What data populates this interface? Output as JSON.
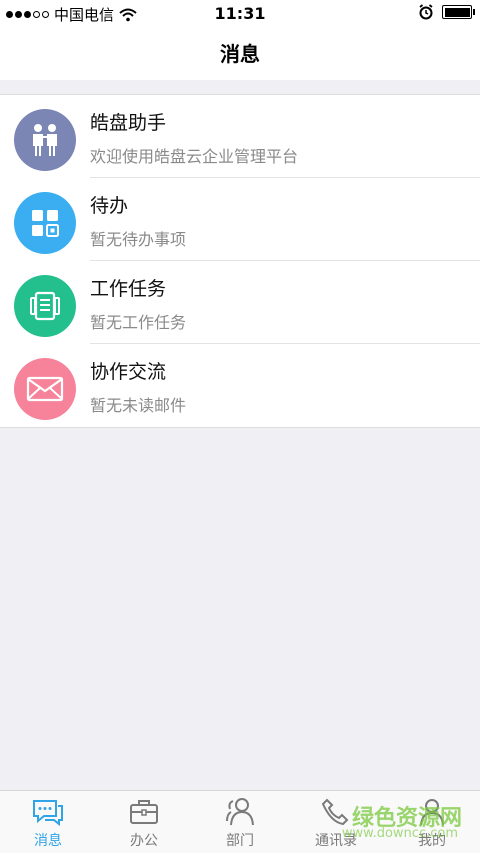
{
  "status_bar": {
    "carrier": "中国电信",
    "time": "11:31"
  },
  "nav": {
    "title": "消息"
  },
  "messages": [
    {
      "title": "皓盘助手",
      "subtitle": "欢迎使用皓盘云企业管理平台",
      "icon": "people-icon",
      "color": "#7b86b5"
    },
    {
      "title": "待办",
      "subtitle": "暂无待办事项",
      "icon": "grid-icon",
      "color": "#3aaef0"
    },
    {
      "title": "工作任务",
      "subtitle": "暂无工作任务",
      "icon": "document-icon",
      "color": "#23c08e"
    },
    {
      "title": "协作交流",
      "subtitle": "暂无未读邮件",
      "icon": "mail-icon",
      "color": "#f6839a"
    }
  ],
  "tabs": [
    {
      "label": "消息",
      "icon": "chat-icon",
      "active": true
    },
    {
      "label": "办公",
      "icon": "briefcase-icon",
      "active": false
    },
    {
      "label": "部门",
      "icon": "people-icon",
      "active": false
    },
    {
      "label": "通讯录",
      "icon": "phone-icon",
      "active": false
    },
    {
      "label": "我的",
      "icon": "user-icon",
      "active": false
    }
  ],
  "watermark": {
    "text": "绿色资源网",
    "url": "www.downcc.com"
  },
  "colors": {
    "accent": "#2fa4e7",
    "background": "#efeff4"
  }
}
